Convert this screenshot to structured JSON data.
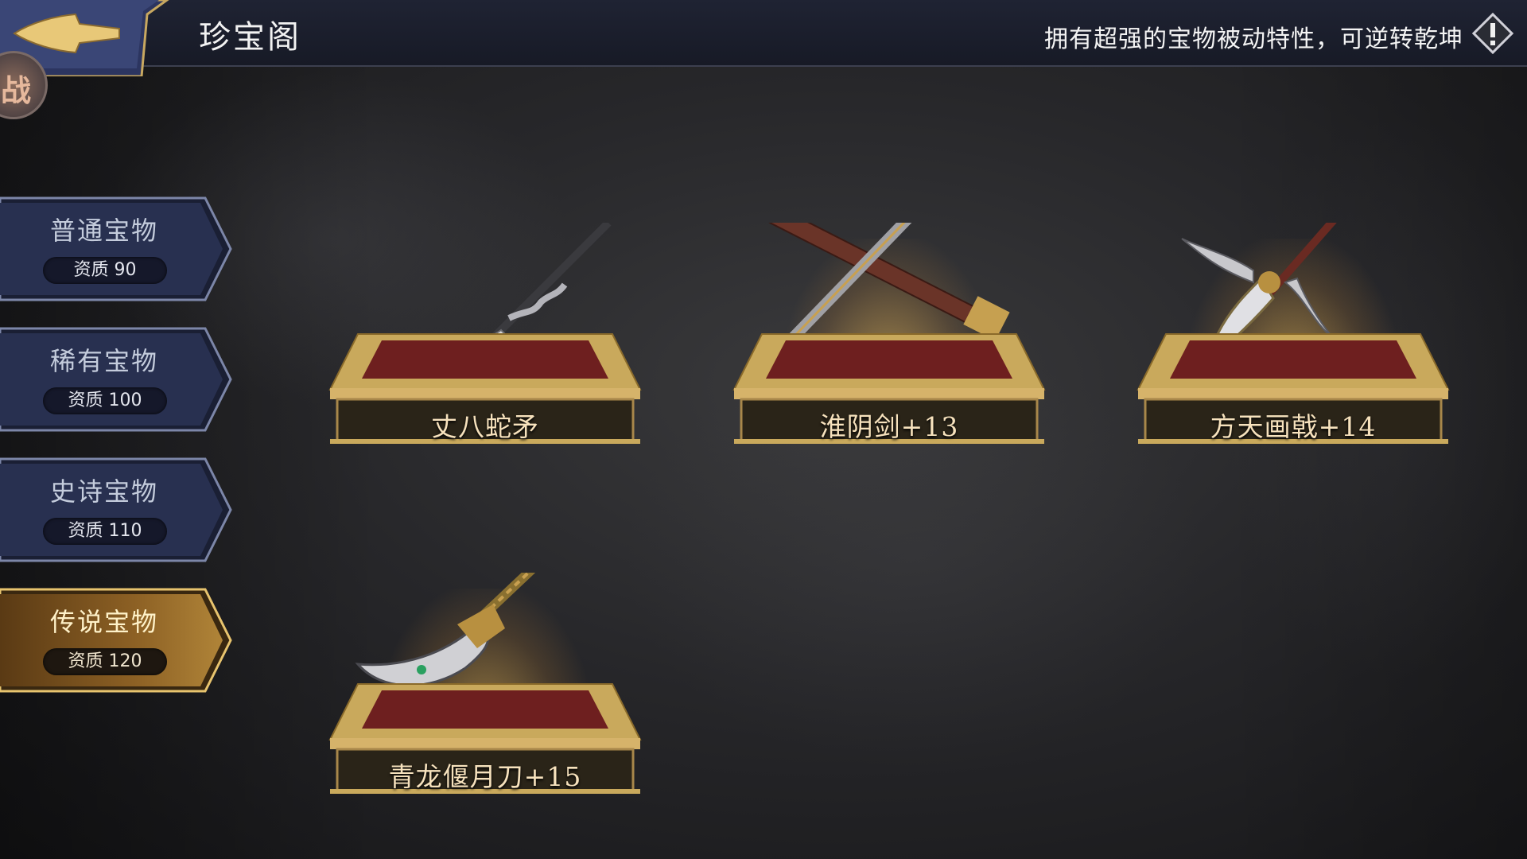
{
  "header": {
    "title": "珍宝阁",
    "description": "拥有超强的宝物被动特性，可逆转乾坤",
    "side_badge_text": "战"
  },
  "tabs": [
    {
      "name": "普通宝物",
      "quality": "资质 90",
      "active": false
    },
    {
      "name": "稀有宝物",
      "quality": "资质 100",
      "active": false
    },
    {
      "name": "史诗宝物",
      "quality": "资质 110",
      "active": false
    },
    {
      "name": "传说宝物",
      "quality": "资质 120",
      "active": true
    }
  ],
  "treasures": [
    {
      "name": "丈八蛇矛",
      "icon": "serpent-spear-icon"
    },
    {
      "name": "淮阴剑+13",
      "icon": "sword-icon"
    },
    {
      "name": "方天画戟+14",
      "icon": "halberd-icon"
    },
    {
      "name": "青龙偃月刀+15",
      "icon": "crescent-blade-icon"
    }
  ],
  "colors": {
    "gold": "#d6b36a",
    "tab_active": "#8a5f22",
    "tab_inactive": "#2a3050",
    "pedestal_red": "#6e1f1f"
  }
}
